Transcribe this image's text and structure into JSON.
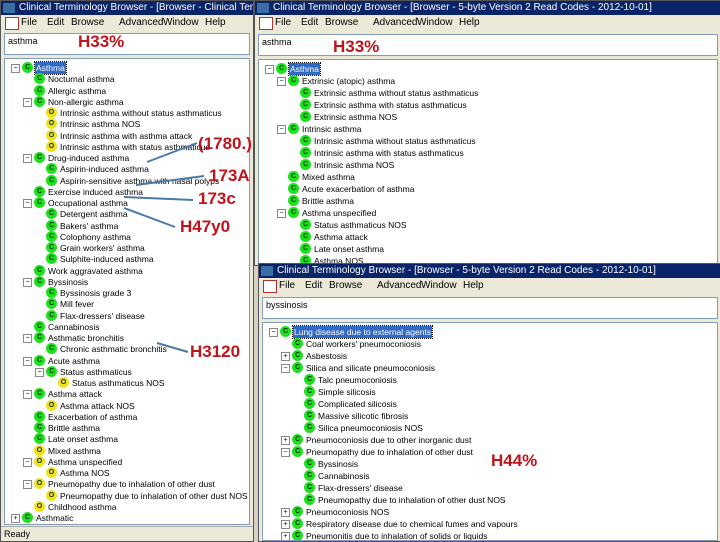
{
  "colors": {
    "green": "#1ee01e",
    "yellow": "#f0e020",
    "annotation": "#c0141c",
    "arrow": "#4a7aa8"
  },
  "menu": [
    "File",
    "Edit",
    "Browse",
    "Advanced",
    "Window",
    "Help"
  ],
  "windows": [
    {
      "title": "Clinical Terminology Browser - [Browser - Clinical Terms (The Re",
      "search": "asthma",
      "status": "Ready",
      "tree": [
        [
          0,
          "G",
          "Asthma",
          "-",
          1
        ],
        [
          1,
          "G",
          "Nocturnal asthma"
        ],
        [
          1,
          "G",
          "Allergic asthma"
        ],
        [
          1,
          "G",
          "Non-allergic asthma",
          "-"
        ],
        [
          2,
          "Y",
          "Intrinsic asthma without status asthmaticus"
        ],
        [
          2,
          "Y",
          "Intrinsic asthma NOS"
        ],
        [
          2,
          "Y",
          "Intrinsic asthma with asthma attack"
        ],
        [
          2,
          "Y",
          "Intrinsic asthma with status asthmaticus"
        ],
        [
          1,
          "G",
          "Drug-induced asthma",
          "-"
        ],
        [
          2,
          "G",
          "Aspirin-induced asthma"
        ],
        [
          2,
          "G",
          "Aspirin-sensitive asthma with nasal polyps"
        ],
        [
          1,
          "G",
          "Exercise induced asthma"
        ],
        [
          1,
          "G",
          "Occupational asthma",
          "-"
        ],
        [
          2,
          "G",
          "Detergent asthma"
        ],
        [
          2,
          "G",
          "Bakers' asthma"
        ],
        [
          2,
          "G",
          "Colophony asthma"
        ],
        [
          2,
          "G",
          "Grain workers' asthma"
        ],
        [
          2,
          "G",
          "Sulphite-induced asthma"
        ],
        [
          1,
          "G",
          "Work aggravated asthma"
        ],
        [
          1,
          "G",
          "Byssinosis",
          "-"
        ],
        [
          2,
          "G",
          "Byssinosis grade 3"
        ],
        [
          2,
          "G",
          "Mill fever"
        ],
        [
          2,
          "G",
          "Flax-dressers' disease"
        ],
        [
          1,
          "G",
          "Cannabinosis"
        ],
        [
          1,
          "G",
          "Asthmatic bronchitis",
          "-"
        ],
        [
          2,
          "G",
          "Chronic asthmatic bronchitis"
        ],
        [
          1,
          "G",
          "Acute asthma",
          "-"
        ],
        [
          2,
          "G",
          "Status asthmaticus",
          "-"
        ],
        [
          3,
          "Y",
          "Status asthmaticus NOS"
        ],
        [
          1,
          "G",
          "Asthma attack",
          "-"
        ],
        [
          2,
          "Y",
          "Asthma attack NOS"
        ],
        [
          1,
          "G",
          "Exacerbation of asthma"
        ],
        [
          1,
          "G",
          "Brittle asthma"
        ],
        [
          1,
          "G",
          "Late onset asthma"
        ],
        [
          1,
          "Y",
          "Mixed asthma"
        ],
        [
          1,
          "Y",
          "Asthma unspecified",
          "-"
        ],
        [
          2,
          "Y",
          "Asthma NOS"
        ],
        [
          1,
          "Y",
          "Pneumopathy due to inhalation of other dust",
          "-"
        ],
        [
          2,
          "Y",
          "Pneumopathy due to inhalation of other dust NOS"
        ],
        [
          1,
          "Y",
          "Childhood asthma"
        ],
        [
          0,
          "G",
          "Asthmatic",
          "+"
        ]
      ]
    },
    {
      "title": "Clinical Terminology Browser - [Browser - 5-byte Version 2 Read Codes - 2012-10-01]",
      "search": "asthma",
      "tree": [
        [
          0,
          "G",
          "Asthma",
          "-",
          1
        ],
        [
          1,
          "G",
          "Extrinsic (atopic) asthma",
          "-"
        ],
        [
          2,
          "G",
          "Extrinsic asthma without status asthmaticus"
        ],
        [
          2,
          "G",
          "Extrinsic asthma with status asthmaticus"
        ],
        [
          2,
          "G",
          "Extrinsic asthma NOS"
        ],
        [
          1,
          "G",
          "Intrinsic asthma",
          "-"
        ],
        [
          2,
          "G",
          "Intrinsic asthma without status asthmaticus"
        ],
        [
          2,
          "G",
          "Intrinsic asthma with status asthmaticus"
        ],
        [
          2,
          "G",
          "Intrinsic asthma NOS"
        ],
        [
          1,
          "G",
          "Mixed asthma"
        ],
        [
          1,
          "G",
          "Acute exacerbation of asthma"
        ],
        [
          1,
          "G",
          "Brittle asthma"
        ],
        [
          1,
          "G",
          "Asthma unspecified",
          "-"
        ],
        [
          2,
          "G",
          "Status asthmaticus NOS"
        ],
        [
          2,
          "G",
          "Asthma attack"
        ],
        [
          2,
          "G",
          "Late onset asthma"
        ],
        [
          2,
          "G",
          "Asthma NOS"
        ]
      ]
    },
    {
      "title": "Clinical Terminology Browser - [Browser - 5-byte Version 2 Read Codes - 2012-10-01]",
      "search": "byssinosis",
      "tree": [
        [
          0,
          "G",
          "Lung disease due to external agents",
          "-",
          1
        ],
        [
          1,
          "G",
          "Coal workers' pneumoconiosis"
        ],
        [
          1,
          "G",
          "Asbestosis",
          "+"
        ],
        [
          1,
          "G",
          "Silica and silicate pneumoconiosis",
          "-"
        ],
        [
          2,
          "G",
          "Talc pneumoconiosis"
        ],
        [
          2,
          "G",
          "Simple silicosis"
        ],
        [
          2,
          "G",
          "Complicated silicosis"
        ],
        [
          2,
          "G",
          "Massive silicotic fibrosis"
        ],
        [
          2,
          "G",
          "Silica pneumoconiosis NOS"
        ],
        [
          1,
          "G",
          "Pneumoconiosis due to other inorganic dust",
          "+"
        ],
        [
          1,
          "G",
          "Pneumopathy due to inhalation of other dust",
          "-"
        ],
        [
          2,
          "G",
          "Byssinosis"
        ],
        [
          2,
          "G",
          "Cannabinosis"
        ],
        [
          2,
          "G",
          "Flax-dressers' disease"
        ],
        [
          2,
          "G",
          "Pneumopathy due to inhalation of other dust NOS"
        ],
        [
          1,
          "G",
          "Pneumoconiosis NOS",
          "+"
        ],
        [
          1,
          "G",
          "Respiratory disease due to chemical fumes and vapours",
          "+"
        ],
        [
          1,
          "G",
          "Pneumonitis due to inhalation of solids or liquids",
          "+"
        ]
      ]
    }
  ],
  "annotations": [
    "H33%",
    "H33%",
    "(1780.)",
    "173A",
    "173c",
    "H47y0",
    "H3120",
    "H44%"
  ]
}
